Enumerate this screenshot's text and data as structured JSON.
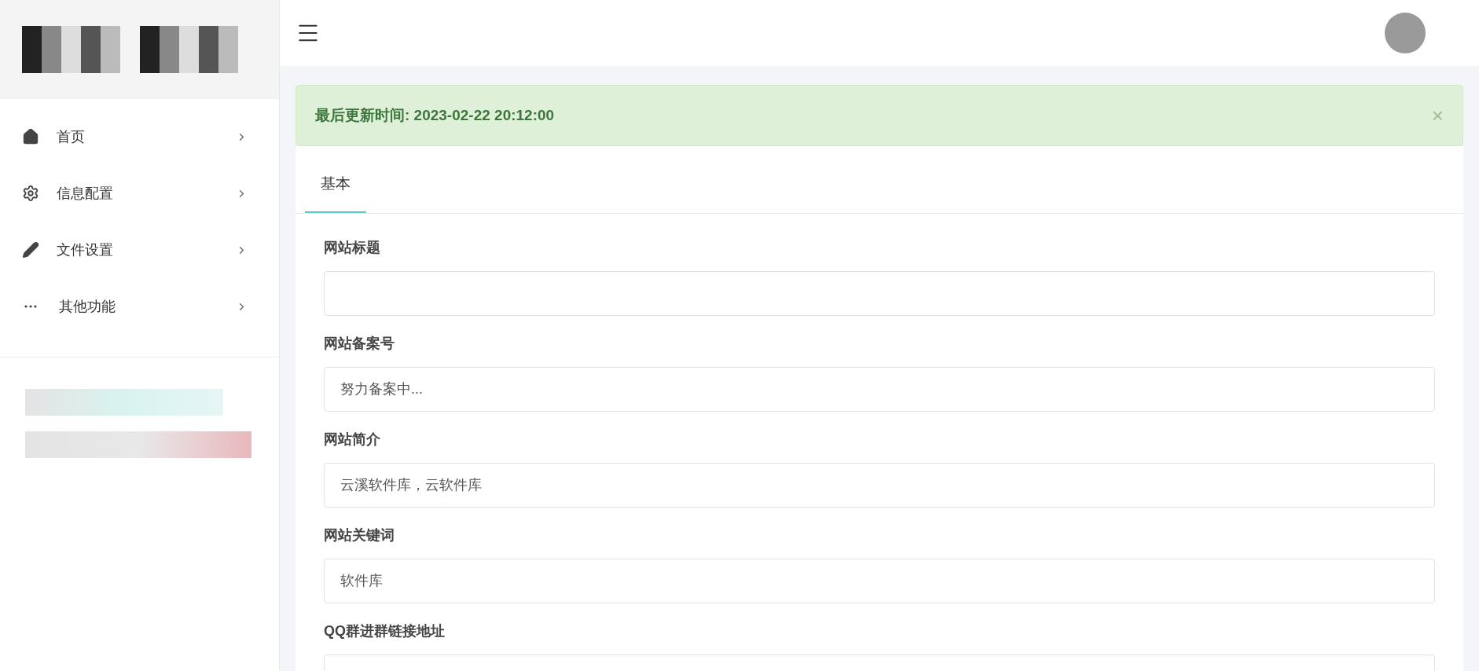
{
  "sidebar": {
    "items": [
      {
        "kind": "home",
        "label": "首页"
      },
      {
        "kind": "gear",
        "label": "信息配置"
      },
      {
        "kind": "pencil",
        "label": "文件设置"
      },
      {
        "kind": "dots",
        "label": "其他功能"
      }
    ]
  },
  "alert": {
    "text": "最后更新时间: 2023-02-22 20:12:00",
    "close": "×"
  },
  "tabs": [
    {
      "label": "基本",
      "selected": true
    }
  ],
  "fields": [
    {
      "label": "网站标题"
    },
    {
      "label": "网站备案号",
      "value": "努力备案中..."
    },
    {
      "label": "网站简介",
      "value": "云溪软件库，云软件库"
    },
    {
      "label": "网站关键词",
      "value": "软件库"
    },
    {
      "label": "QQ群进群链接地址"
    }
  ]
}
